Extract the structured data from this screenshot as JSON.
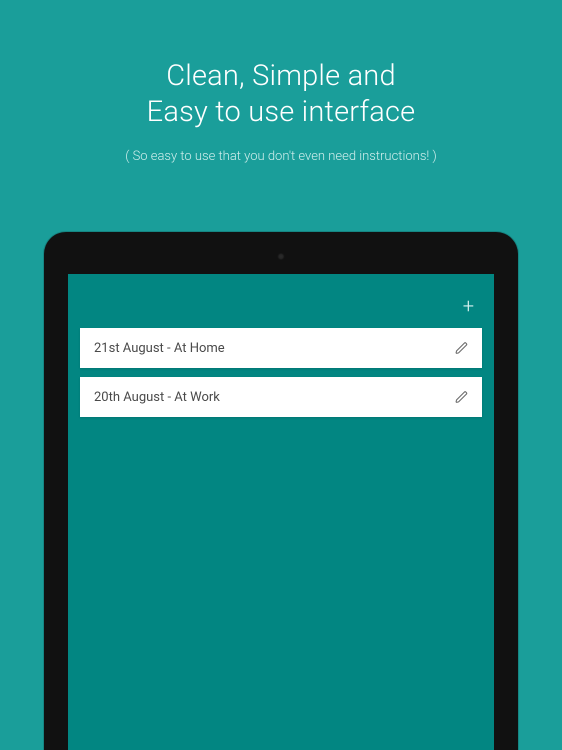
{
  "hero": {
    "title_line1": "Clean, Simple and",
    "title_line2": "Easy to use interface",
    "subtitle": "( So easy to use that you don't even need instructions! )"
  },
  "app": {
    "add_glyph": "+",
    "items": [
      {
        "label": "21st August - At Home"
      },
      {
        "label": "20th August - At Work"
      }
    ]
  },
  "colors": {
    "background": "#1a9e9a",
    "screen": "#028682",
    "card": "#ffffff",
    "text_dark": "#4a4a4a"
  }
}
